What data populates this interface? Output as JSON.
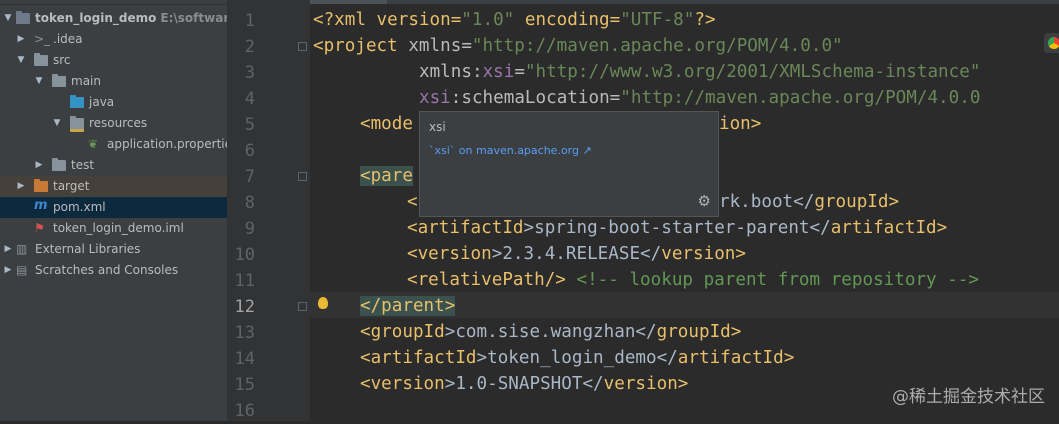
{
  "project": {
    "items": [
      {
        "label": "token_login_demo",
        "hint": "E:\\software\\I",
        "icon": "module-folder-icon",
        "expanded": true
      },
      {
        "label": ".idea",
        "icon": "folder-icon",
        "expanded": false
      },
      {
        "label": "src",
        "icon": "folder-icon",
        "expanded": true
      },
      {
        "label": "main",
        "icon": "folder-icon",
        "expanded": true
      },
      {
        "label": "java",
        "icon": "source-folder-icon"
      },
      {
        "label": "resources",
        "icon": "resources-folder-icon",
        "expanded": true
      },
      {
        "label": "application.properties",
        "icon": "spring-properties-icon"
      },
      {
        "label": "test",
        "icon": "folder-icon",
        "expanded": false
      },
      {
        "label": "target",
        "icon": "excluded-folder-icon",
        "expanded": false
      },
      {
        "label": "pom.xml",
        "icon": "maven-icon"
      },
      {
        "label": "token_login_demo.iml",
        "icon": "iml-file-icon"
      },
      {
        "label": "External Libraries",
        "icon": "libraries-icon",
        "expanded": false
      },
      {
        "label": "Scratches and Consoles",
        "icon": "scratches-icon",
        "expanded": false
      }
    ]
  },
  "editor": {
    "line_numbers": [
      "1",
      "2",
      "3",
      "4",
      "5",
      "6",
      "7",
      "8",
      "9",
      "10",
      "11",
      "12",
      "13",
      "14",
      "15",
      "16"
    ],
    "current_line": "12",
    "lines": {
      "l1": {
        "a": "<?xml version=",
        "b": "\"1.0\"",
        "c": " encoding=",
        "d": "\"UTF-8\"",
        "e": "?>"
      },
      "l2": {
        "a": "<project ",
        "b": "xmlns",
        "c": "=",
        "d": "\"http://maven.apache.org/POM/4.0.0\""
      },
      "l3": {
        "a": "xmlns",
        "b": ":",
        "c": "xsi",
        "d": "=",
        "e": "\"http://www.w3.org/2001/XMLSchema-instance\""
      },
      "l4": {
        "a": "xsi",
        "b": ":",
        "c": "schemaLocation",
        "d": "=",
        "e": "\"http://maven.apache.org/POM/4.0.0"
      },
      "l5": {
        "a": "<mode",
        "b": "ion>"
      },
      "l7": {
        "a": "<pare"
      },
      "l8": {
        "a": "<",
        "b": "rk.boot</",
        "c": "groupId",
        "d": ">"
      },
      "l9": {
        "a": "<",
        "b": "artifactId",
        "c": ">spring-boot-starter-parent</",
        "d": "artifactId",
        "e": ">"
      },
      "l10": {
        "a": "<",
        "b": "version",
        "c": ">2.3.4.RELEASE</",
        "d": "version",
        "e": ">"
      },
      "l11": {
        "a": "<",
        "b": "relativePath",
        "c": "/> ",
        "d": "<!-- lookup parent from repository -->"
      },
      "l12": {
        "a": "</parent>"
      },
      "l13": {
        "a": "<",
        "b": "groupId",
        "c": ">com.sise.wangzhan</",
        "d": "groupId",
        "e": ">"
      },
      "l14": {
        "a": "<",
        "b": "artifactId",
        "c": ">token_login_demo</",
        "d": "artifactId",
        "e": ">"
      },
      "l15": {
        "a": "<",
        "b": "version",
        "c": ">1.0-SNAPSHOT</",
        "d": "version",
        "e": ">"
      }
    }
  },
  "popup": {
    "title": "xsi",
    "link": "`xsi` on maven.apache.org ↗"
  },
  "watermark": "@稀土掘金技术社区",
  "colors": {
    "tag": "#e8bf6a",
    "string": "#6a8759",
    "namespace": "#9876aa",
    "comment": "#629755",
    "selection": "#0d293e"
  }
}
